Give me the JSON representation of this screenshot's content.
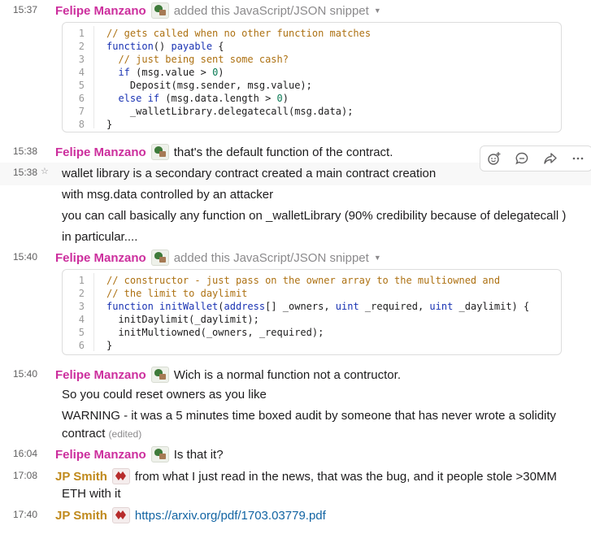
{
  "messages": [
    {
      "time": "15:37",
      "name": "Felipe Manzano",
      "action": "added this JavaScript/JSON snippet"
    },
    {
      "time": "15:38",
      "name": "Felipe Manzano",
      "text": "that's the default function of the contract."
    },
    {
      "time": "15:38",
      "lines": [
        "wallet library is a secondary contract created a main contract creation",
        "with msg.data controlled by an attacker",
        "you can call basically any function on _walletLibrary (90% credibility because of delegatecall )",
        "in particular...."
      ]
    },
    {
      "time": "15:40",
      "name": "Felipe Manzano",
      "action": "added this JavaScript/JSON snippet"
    },
    {
      "time": "15:40",
      "name": "Felipe Manzano",
      "text": "Wich is a normal function not a contructor.",
      "lines": [
        "So you could reset owners as you like",
        "WARNING - it was a 5 minutes time boxed audit by someone that has never wrote a solidity",
        "contract"
      ],
      "edited": "(edited)"
    },
    {
      "time": "16:04",
      "name": "Felipe Manzano",
      "text": "Is that it?"
    },
    {
      "time": "17:08",
      "name": "JP Smith",
      "text": "from what I just read in the news, that was the bug, and it people stole >30MM",
      "line2": "ETH with it"
    },
    {
      "time": "17:40",
      "name": "JP Smith",
      "link": "https://arxiv.org/pdf/1703.03779.pdf"
    }
  ],
  "snippet1": [
    "// gets called when no other function matches",
    "function() payable {",
    "  // just being sent some cash?",
    "  if (msg.value > 0)",
    "    Deposit(msg.sender, msg.value);",
    "  else if (msg.data.length > 0)",
    "    _walletLibrary.delegatecall(msg.data);",
    "}"
  ],
  "snippet2": [
    "// constructor - just pass on the owner array to the multiowned and",
    "// the limit to daylimit",
    "function initWallet(address[] _owners, uint _required, uint _daylimit) {",
    "  initDaylimit(_daylimit);",
    "  initMultiowned(_owners, _required);",
    "}"
  ],
  "icons": {
    "felipe_avatar": "tree-icon",
    "jp_avatar": "red-emblem-icon",
    "toolbar": [
      "add-reaction-icon",
      "reply-thread-icon",
      "share-icon",
      "more-actions-icon"
    ],
    "star": "star-icon"
  },
  "colors": {
    "felipe_name": "#cc2e9d",
    "jp_name": "#c08a1d",
    "link": "#1264a3",
    "code_comment": "#ad7112",
    "code_keyword": "#1a33b3"
  }
}
